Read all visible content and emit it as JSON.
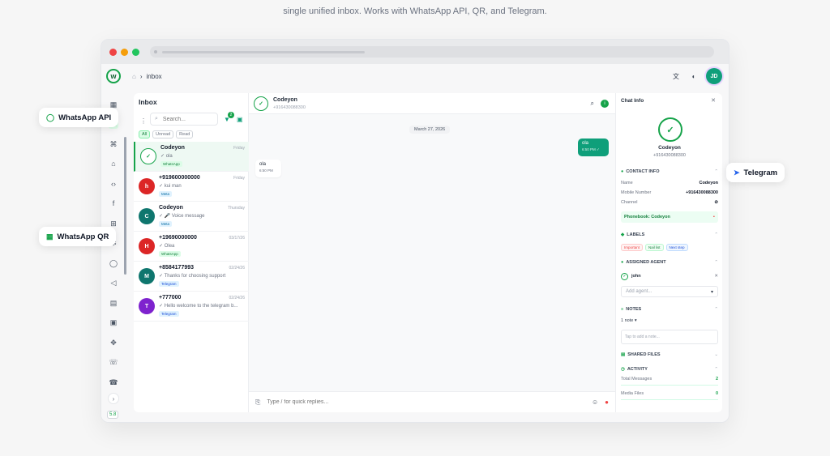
{
  "headline": "single unified inbox. Works with WhatsApp API, QR, and Telegram.",
  "colors": {
    "brand": "#0f9f7a",
    "accent_green": "#16a34a",
    "danger": "#ef4444"
  },
  "window": {
    "traffic_lights": [
      "#ef4444",
      "#f59e0b",
      "#22c55e"
    ]
  },
  "breadcrumb": {
    "home_icon": "home-icon",
    "current": "inbox"
  },
  "topbar": {
    "avatar_initials": "JD"
  },
  "sidebar": {
    "logo_letter": "w",
    "collapse_label": "›",
    "version": "5.8",
    "icons": [
      "dashboard-icon",
      "chat-icon",
      "network-icon",
      "home-icon",
      "code-icon",
      "facebook-icon",
      "flow-icon",
      "gear-icon",
      "whatsapp-icon",
      "megaphone-icon",
      "wallet-icon",
      "contacts-icon",
      "move-icon",
      "phone-icon",
      "phone-forward-icon"
    ]
  },
  "inbox": {
    "title": "Inbox",
    "search_placeholder": "Search...",
    "filter_badge": "2",
    "filters": [
      "All",
      "Unread",
      "Read"
    ],
    "conversations": [
      {
        "name": "Codeyon",
        "time": "Friday",
        "preview": "✓ ola",
        "tag": "WhatsApp",
        "tag_type": "wa",
        "initial": "✓",
        "color": "#ffffff",
        "is_logo": true,
        "selected": true
      },
      {
        "name": "+919600000000",
        "time": "Friday",
        "preview": "✓ kui man",
        "tag": "Meta",
        "tag_type": "me",
        "initial": "h",
        "color": "#dc2626"
      },
      {
        "name": "Codeyon",
        "time": "Thursday",
        "preview": "✓ 🎤 Voice message",
        "tag": "Meta",
        "tag_type": "me",
        "initial": "C",
        "color": "#0f766e"
      },
      {
        "name": "+19690000000",
        "time": "03/17/26",
        "preview": "✓ Olea",
        "tag": "WhatsApp",
        "tag_type": "wa",
        "initial": "H",
        "color": "#dc2626"
      },
      {
        "name": "+8584177993",
        "time": "02/24/26",
        "preview": "✓ Thanks for choosing support",
        "tag": "Telegram",
        "tag_type": "tl",
        "initial": "M",
        "color": "#0f766e"
      },
      {
        "name": "+777000",
        "time": "02/24/26",
        "preview": "✓ Hello welcome to the telegram b...",
        "tag": "Telegram",
        "tag_type": "tl",
        "initial": "T",
        "color": "#7e22ce"
      }
    ]
  },
  "chat": {
    "name": "Codeyon",
    "phone": "+916430088300",
    "date_chip": "March 27, 2026",
    "messages": [
      {
        "dir": "out",
        "text": "ola",
        "time": "6:50 PM ✓"
      },
      {
        "dir": "in",
        "text": "ola",
        "time": "6:50 PM"
      }
    ],
    "composer_placeholder": "Type / for quick replies..."
  },
  "chat_info": {
    "title": "Chat Info",
    "name": "Codeyon",
    "phone": "+916430088300",
    "contact_info": {
      "heading": "CONTACT INFO",
      "rows": [
        {
          "k": "Name",
          "v": "Codeyon"
        },
        {
          "k": "Mobile Number",
          "v": "+916430088300"
        },
        {
          "k": "Channel",
          "v": "⊘"
        }
      ],
      "phonebook": "Phonebook: Codeyon"
    },
    "labels": {
      "heading": "LABELS",
      "items": [
        "Important",
        "Nail list",
        "Next step"
      ]
    },
    "assigned_agent": {
      "heading": "ASSIGNED AGENT",
      "agent": "john",
      "add_placeholder": "Add agent..."
    },
    "notes": {
      "heading": "NOTES",
      "count": "1 note ▾",
      "input_placeholder": "Tap to add a note..."
    },
    "shared_files": {
      "heading": "SHARED FILES"
    },
    "activity": {
      "heading": "ACTIVITY",
      "rows": [
        {
          "k": "Total Messages",
          "v": "2"
        },
        {
          "k": "Media Files",
          "v": "0"
        }
      ]
    }
  },
  "callouts": {
    "whatsapp_api": "WhatsApp API",
    "whatsapp_qr": "WhatsApp QR",
    "telegram": "Telegram"
  }
}
